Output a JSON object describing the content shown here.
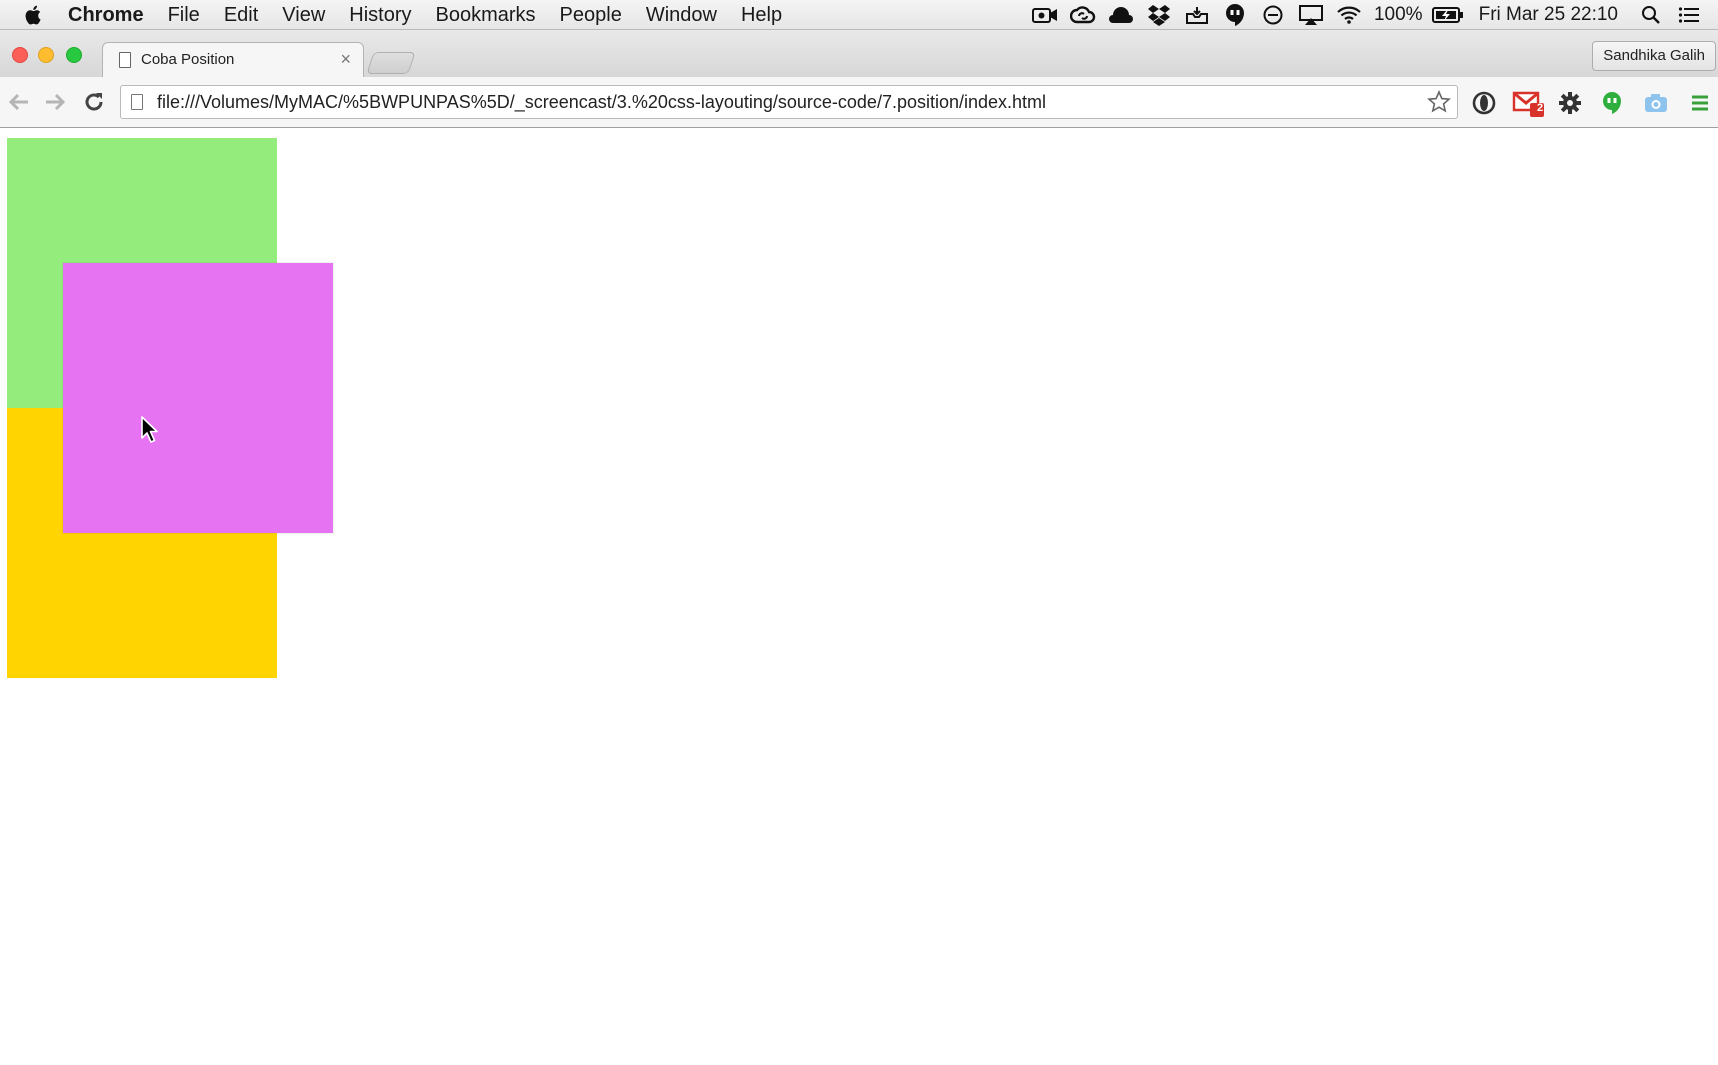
{
  "menubar": {
    "app_name": "Chrome",
    "items": [
      "File",
      "Edit",
      "View",
      "History",
      "Bookmarks",
      "People",
      "Window",
      "Help"
    ],
    "battery": "100%",
    "datetime": "Fri Mar 25  22:10"
  },
  "tab": {
    "title": "Coba Position",
    "close_glyph": "×"
  },
  "profile": {
    "name": "Sandhika Galih"
  },
  "toolbar": {
    "url": "file:///Volumes/MyMAC/%5BWPUNPAS%5D/_screencast/3.%20css-layouting/source-code/7.position/index.html",
    "gmail_badge": "2"
  },
  "page": {
    "boxes": [
      {
        "name": "green-box",
        "color": "#93ec7b"
      },
      {
        "name": "yellow-box",
        "color": "#ffd400"
      },
      {
        "name": "pink-box",
        "color": "#e674f2"
      }
    ]
  },
  "colors": {
    "close": "#fc5f57",
    "minimize": "#fdbd2e",
    "maximize": "#28c840",
    "gmail_red": "#d8332b",
    "ext_green": "#2eae3c",
    "menu_green": "#3aa13a"
  }
}
